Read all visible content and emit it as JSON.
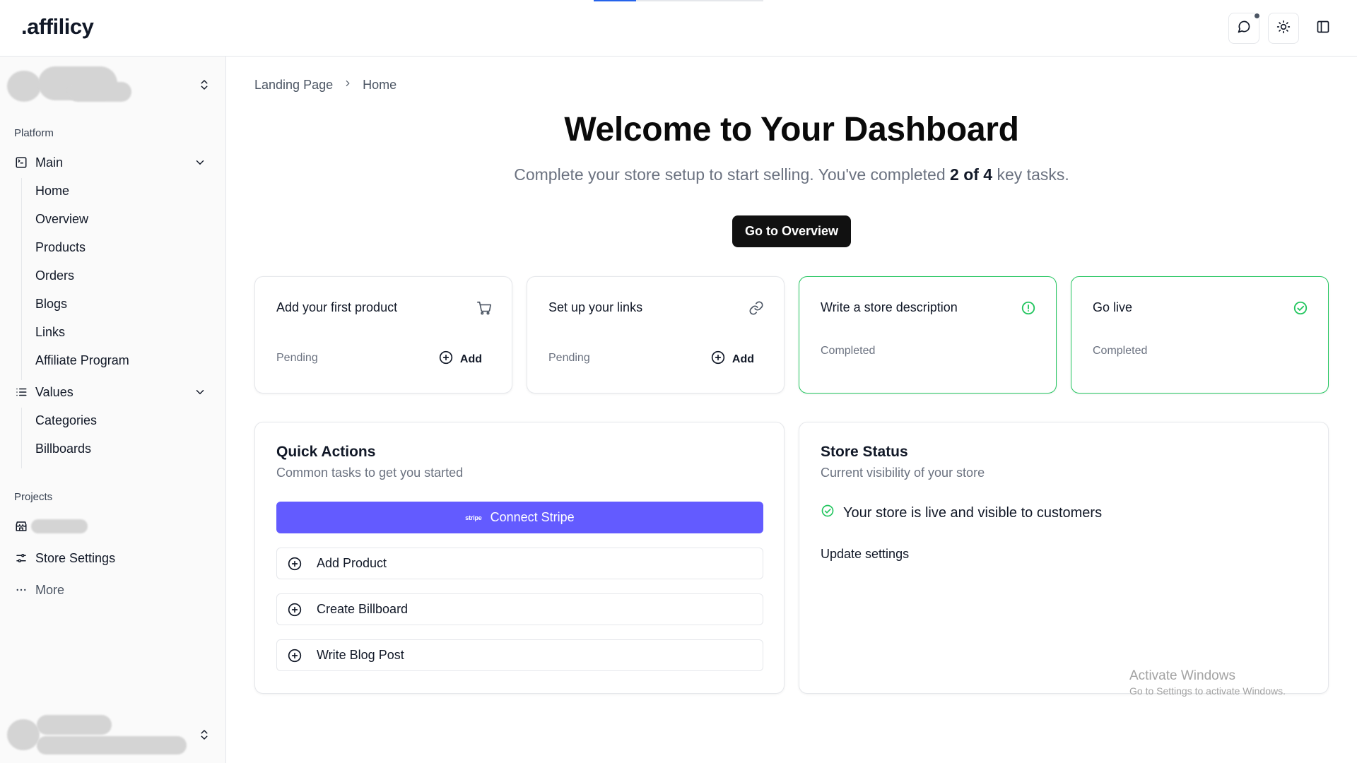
{
  "app": {
    "logo": ".affilicy",
    "top_progress": 0.25
  },
  "topbar": {
    "icons": [
      "message-icon",
      "sun-icon",
      "sidebar-toggle-icon"
    ]
  },
  "sidebar": {
    "sections": {
      "platform": "Platform",
      "projects": "Projects"
    },
    "main_group": {
      "label": "Main",
      "items": [
        "Home",
        "Overview",
        "Products",
        "Orders",
        "Blogs",
        "Links",
        "Affiliate Program"
      ]
    },
    "values_group": {
      "label": "Values",
      "items": [
        "Categories",
        "Billboards"
      ]
    },
    "projects": {
      "store_settings": "Store Settings",
      "more": "More"
    }
  },
  "breadcrumb": {
    "parent": "Landing Page",
    "current": "Home"
  },
  "hero": {
    "title": "Welcome to Your Dashboard",
    "subtitle_prefix": "Complete your store setup to start selling. You've completed ",
    "subtitle_count": "2 of 4",
    "subtitle_suffix": " key tasks.",
    "cta": "Go to Overview"
  },
  "tasks": [
    {
      "title": "Add your first product",
      "status": "Pending",
      "action": "Add",
      "icon": "cart-icon"
    },
    {
      "title": "Set up your links",
      "status": "Pending",
      "action": "Add",
      "icon": "link-icon"
    },
    {
      "title": "Write a store description",
      "status": "Completed",
      "icon": "alert-circle-icon"
    },
    {
      "title": "Go live",
      "status": "Completed",
      "icon": "check-circle-icon"
    }
  ],
  "quick_actions": {
    "title": "Quick Actions",
    "subtitle": "Common tasks to get you started",
    "stripe_mark": "stripe",
    "stripe_label": "Connect Stripe",
    "buttons": [
      "Add Product",
      "Create Billboard",
      "Write Blog Post"
    ]
  },
  "store_status": {
    "title": "Store Status",
    "subtitle": "Current visibility of your store",
    "live_text": "Your store is live and visible to customers",
    "update_link": "Update settings"
  },
  "watermark": {
    "line1": "Activate Windows",
    "line2": "Go to Settings to activate Windows."
  },
  "colors": {
    "accent_dark": "#111111",
    "stripe": "#635bff",
    "success": "#22c55e",
    "progress": "#2563eb"
  }
}
